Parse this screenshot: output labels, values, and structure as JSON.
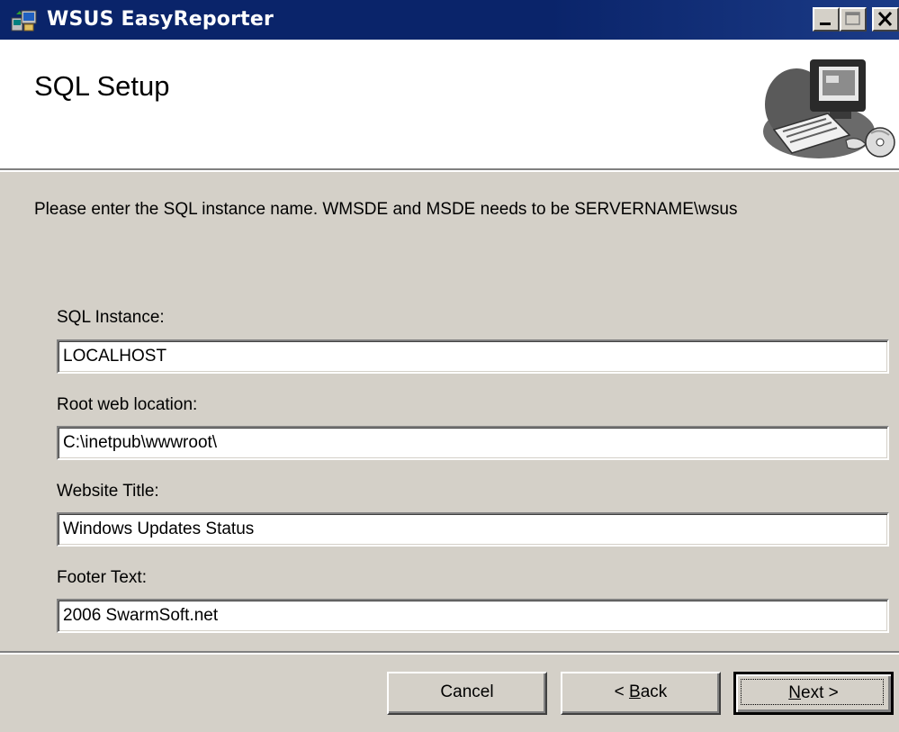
{
  "window": {
    "title": "WSUS EasyReporter",
    "titlebar_color": "#0a246a"
  },
  "icons": {
    "app": "installer-computer-icon",
    "minimize": "minimize-icon",
    "maximize": "maximize-icon",
    "close": "close-icon",
    "hero": "computer-workstation-illustration"
  },
  "header": {
    "title": "SQL Setup"
  },
  "instructions": "Please enter the SQL instance name. WMSDE and MSDE needs to be SERVERNAME\\wsus",
  "fields": [
    {
      "label": "SQL Instance:",
      "value": "LOCALHOST"
    },
    {
      "label": "Root web location:",
      "value": "C:\\inetpub\\wwwroot\\"
    },
    {
      "label": "Website Title:",
      "value": "Windows Updates Status"
    },
    {
      "label": "Footer Text:",
      "value": "2006 SwarmSoft.net"
    }
  ],
  "buttons": {
    "cancel": "Cancel",
    "back_prefix": "< ",
    "back_accel": "B",
    "back_rest": "ack",
    "next_accel": "N",
    "next_rest": "ext >"
  }
}
